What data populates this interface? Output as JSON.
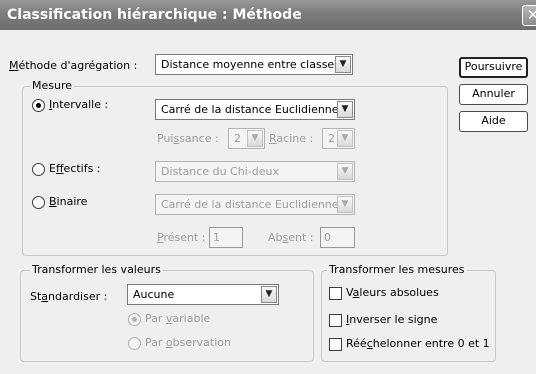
{
  "window": {
    "title": "Classification hiérarchique : Méthode",
    "close_glyph": "✕"
  },
  "method": {
    "label_pre": "",
    "label_u": "M",
    "label_post": "éthode d'agrégation :",
    "value": "Distance moyenne entre classes"
  },
  "buttons": {
    "poursuivre": "Poursuivre",
    "annuler": "Annuler",
    "aide": "Aide"
  },
  "mesure": {
    "legend": "Mesure",
    "intervalle": {
      "u": "I",
      "rest": "ntervalle :",
      "selected": true,
      "value": "Carré de la distance Euclidienne"
    },
    "puissance": {
      "pre": "Pui",
      "u": "s",
      "post": "sance :",
      "value": "2"
    },
    "racine": {
      "u": "R",
      "post": "acine :",
      "value": "2"
    },
    "effectifs": {
      "pre": "E",
      "u": "f",
      "post": "fectifs :",
      "selected": false,
      "value": "Distance du Chi-deux"
    },
    "binaire": {
      "u": "B",
      "post": "inaire",
      "selected": false,
      "value": "Carré de la distance Euclidienne"
    },
    "present": {
      "u": "P",
      "post": "résent :",
      "value": "1"
    },
    "absent": {
      "pre": "Ab",
      "u": "s",
      "post": "ent :",
      "value": "0"
    }
  },
  "transformer_valeurs": {
    "legend": "Transformer les valeurs",
    "standardiser": {
      "pre": "St",
      "u": "a",
      "post": "ndardiser :",
      "value": "Aucune"
    },
    "par_variable": {
      "pre": "Par ",
      "u": "v",
      "post": "ariable",
      "selected": true
    },
    "par_observation": {
      "pre": "Par ",
      "u": "o",
      "post": "bservation",
      "selected": false
    }
  },
  "transformer_mesures": {
    "legend": "Transformer les mesures",
    "valeurs_absolues": {
      "pre": "V",
      "u": "a",
      "post": "leurs absolues",
      "checked": false
    },
    "inverser": {
      "pre": "",
      "u": "I",
      "post": "nverser le signe",
      "checked": false
    },
    "reechelonner": {
      "pre": "Réé",
      "u": "c",
      "post": "helonner entre 0 et 1",
      "checked": false
    }
  },
  "icons": {
    "dropdown": "chevron-down-icon",
    "close": "close-icon"
  }
}
